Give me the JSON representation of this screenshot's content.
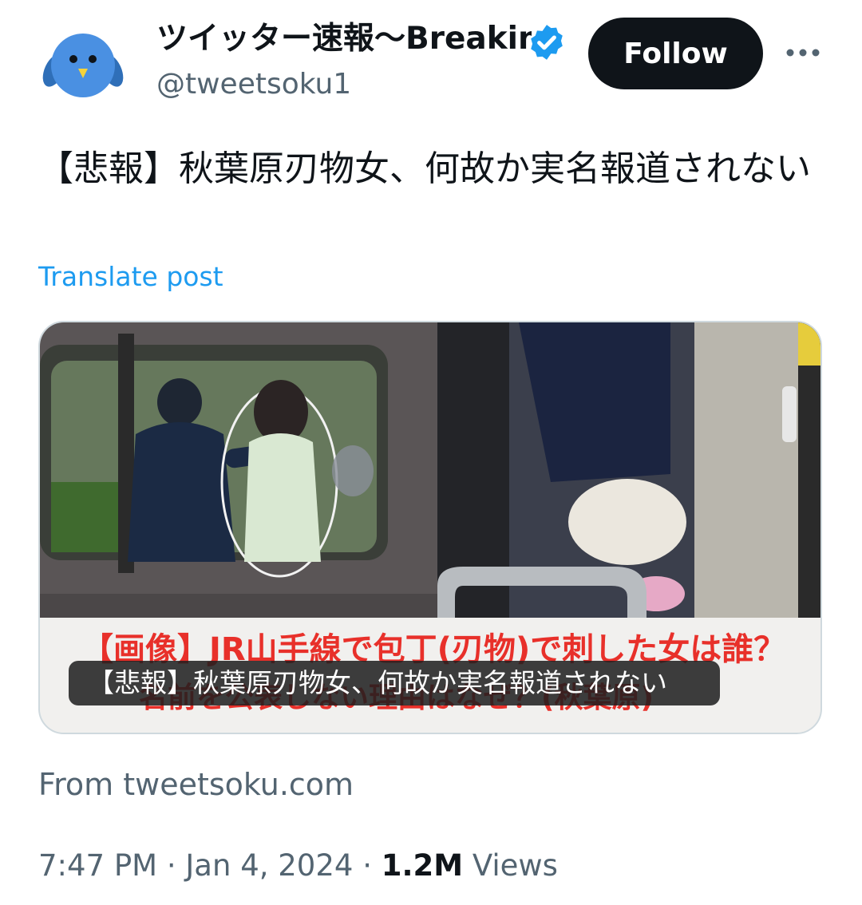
{
  "author": {
    "display_name": "ツイッター速報〜BreakingNews",
    "handle": "@tweetsoku1",
    "avatar_icon": "bird-avatar-icon",
    "verified_icon": "verified-badge-icon"
  },
  "actions": {
    "follow_label": "Follow",
    "more_icon": "more-options-icon"
  },
  "post": {
    "text": "【悲報】秋葉原刃物女、何故か実名報道されない",
    "translate_label": "Translate post"
  },
  "card": {
    "overlay_title": "【悲報】秋葉原刃物女、何故か実名報道されない",
    "banner_line1": "【画像】JR山手線で包丁(刃物)で刺した女は誰？",
    "banner_line2": "名前を公表しない理由はなぜ？(秋葉原)",
    "source": "From tweetsoku.com"
  },
  "meta": {
    "time": "7:47 PM",
    "date": "Jan 4, 2024",
    "views_count": "1.2M",
    "views_label": "Views"
  },
  "colors": {
    "accent": "#1d9bf0",
    "follow_bg": "#0f1419",
    "secondary_text": "#536471",
    "banner_red": "#e8302a"
  }
}
